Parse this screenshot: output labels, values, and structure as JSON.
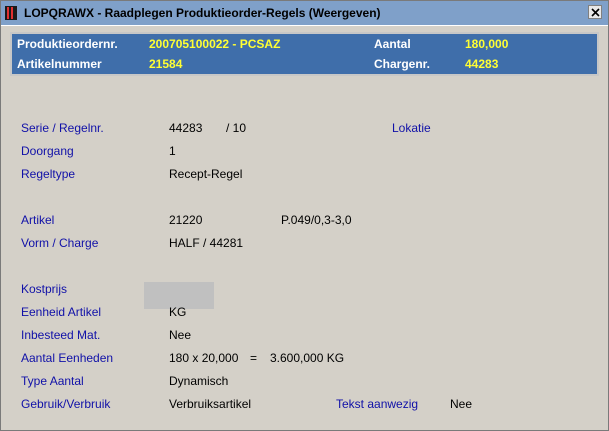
{
  "window": {
    "title": "LOPQRAWX - Raadplegen Produktieorder-Regels (Weergeven)",
    "close_glyph": "close-icon"
  },
  "header": {
    "order_label": "Produktieordernr.",
    "order_value": "200705100022 - PCSAZ",
    "quantity_label": "Aantal",
    "quantity_value": "180,000",
    "article_label": "Artikelnummer",
    "article_value": "21584",
    "batch_label": "Chargenr.",
    "batch_value": "44283"
  },
  "fields": {
    "serie_label": "Serie / Regelnr.",
    "serie_value": "44283",
    "regelnr_value": "/ 10",
    "lokatie_label": "Lokatie",
    "doorgang_label": "Doorgang",
    "doorgang_value": "1",
    "regeltype_label": "Regeltype",
    "regeltype_value": "Recept-Regel",
    "artikel_label": "Artikel",
    "artikel_value": "21220",
    "artikel_desc": "P.049/0,3-3,0",
    "vorm_label": "Vorm / Charge",
    "vorm_value": "HALF / 44281",
    "kostprijs_label": "Kostprijs",
    "eenheid_label": "Eenheid Artikel",
    "eenheid_value": "KG",
    "inbesteed_label": "Inbesteed Mat.",
    "inbesteed_value": "Nee",
    "aantal_eenheden_label": "Aantal Eenheden",
    "aantal_eenheden_calc": "180 x 20,000",
    "aantal_eenheden_eq": "=",
    "aantal_eenheden_result": "3.600,000 KG",
    "type_aantal_label": "Type Aantal",
    "type_aantal_value": "Dynamisch",
    "gebruik_label": "Gebruik/Verbruik",
    "gebruik_value": "Verbruiksartikel",
    "tekst_label": "Tekst aanwezig",
    "tekst_value": "Nee"
  },
  "colors": {
    "title_bar": "#7fa0c9",
    "header_panel": "#3f6eaa",
    "header_value": "#ffff33",
    "field_label": "#1010a8",
    "body": "#d4d0c8"
  }
}
